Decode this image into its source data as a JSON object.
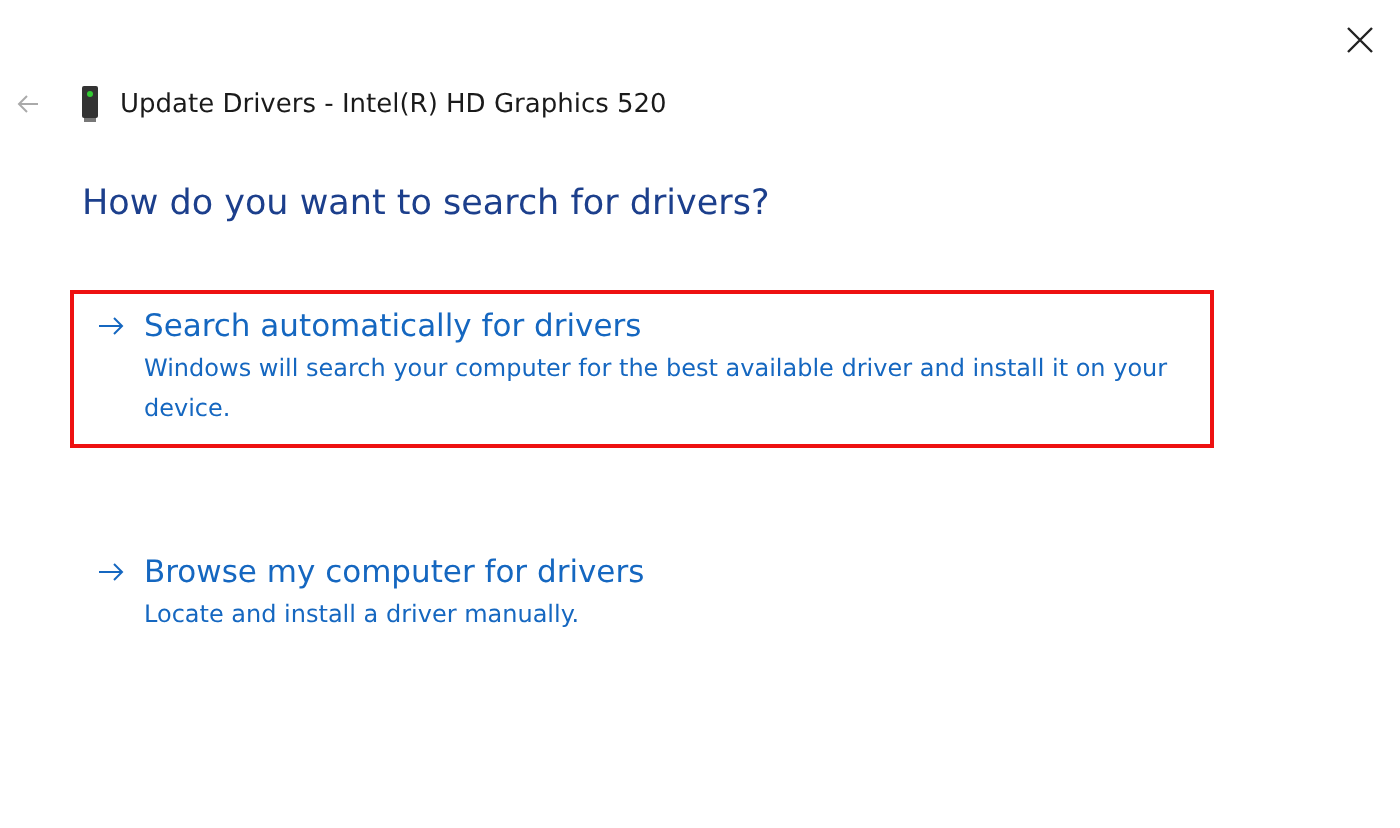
{
  "window": {
    "title": "Update Drivers - Intel(R) HD Graphics 520"
  },
  "heading": "How do you want to search for drivers?",
  "options": [
    {
      "title": "Search automatically for drivers",
      "description": "Windows will search your computer for the best available driver and install it on your device.",
      "highlighted": true
    },
    {
      "title": "Browse my computer for drivers",
      "description": "Locate and install a driver manually.",
      "highlighted": false
    }
  ]
}
